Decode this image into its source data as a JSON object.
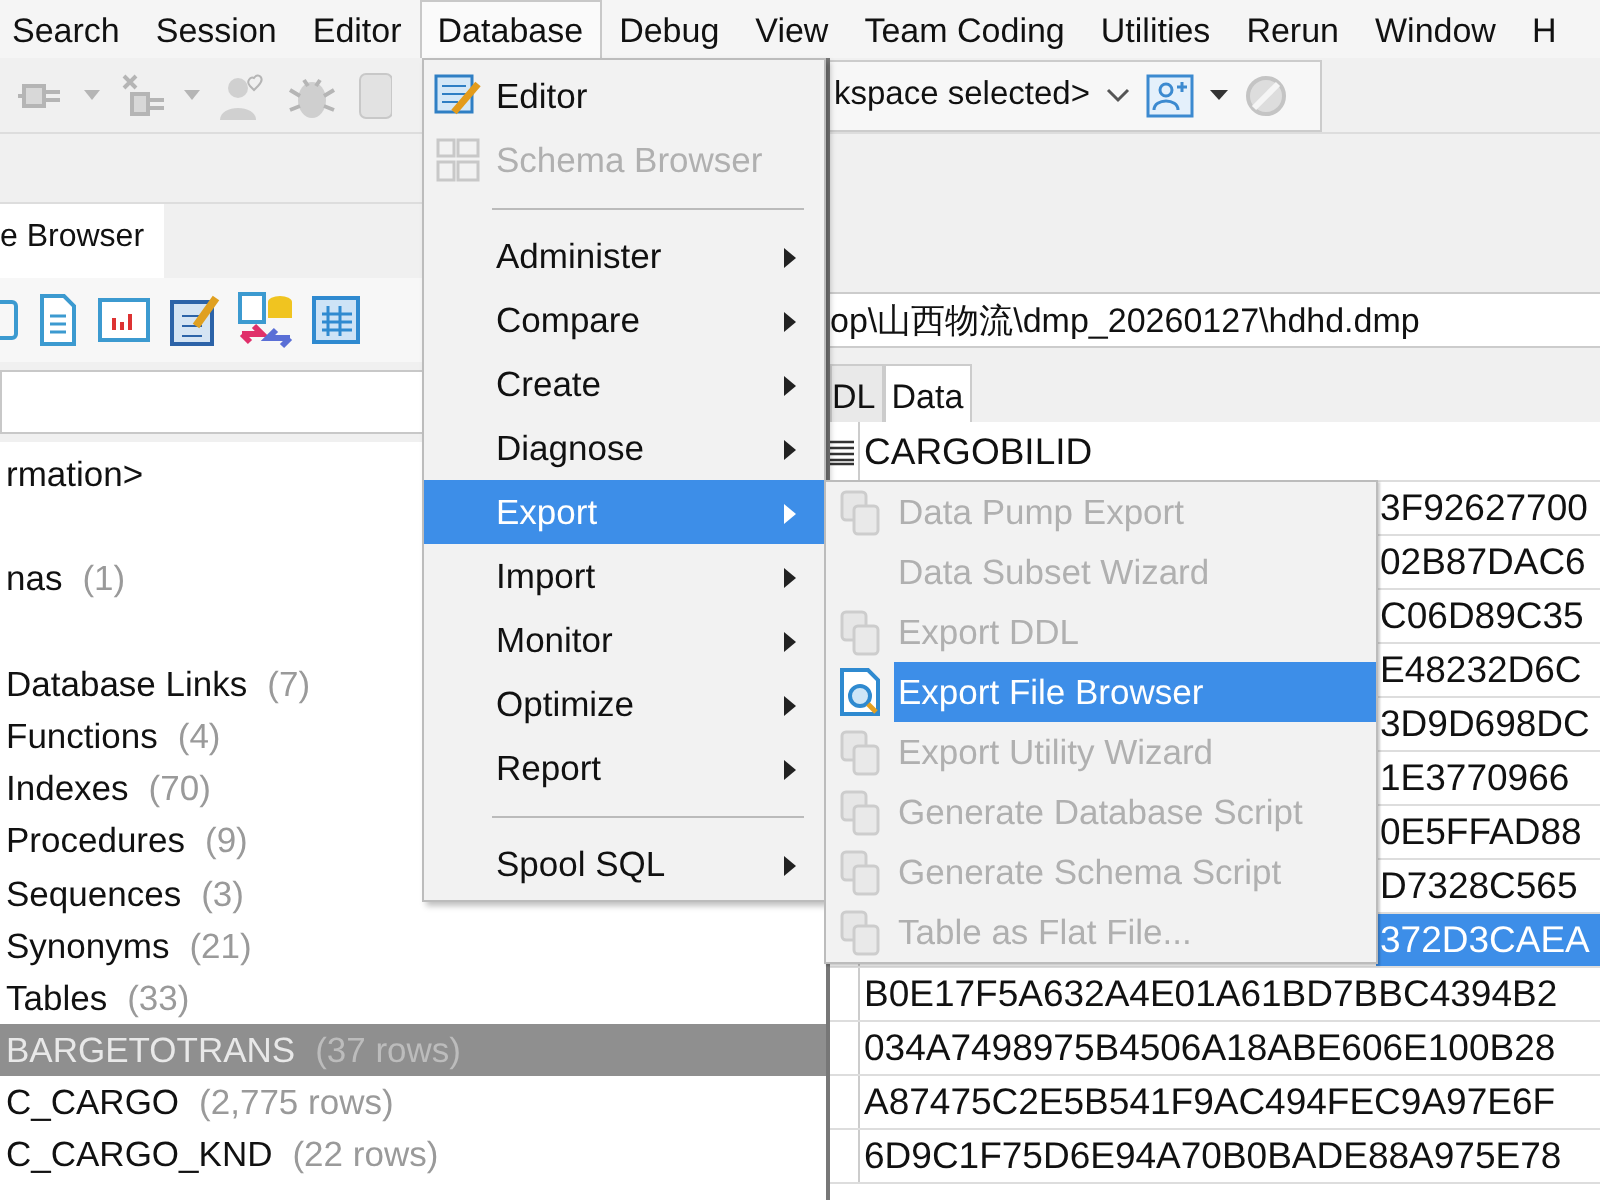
{
  "menubar": [
    {
      "label": "Search",
      "selected": false
    },
    {
      "label": "Session",
      "selected": false
    },
    {
      "label": "Editor",
      "selected": false
    },
    {
      "label": "Database",
      "selected": true
    },
    {
      "label": "Debug",
      "selected": false
    },
    {
      "label": "View",
      "selected": false
    },
    {
      "label": "Team Coding",
      "selected": false
    },
    {
      "label": "Utilities",
      "selected": false
    },
    {
      "label": "Rerun",
      "selected": false
    },
    {
      "label": "Window",
      "selected": false
    },
    {
      "label": "H",
      "selected": false
    }
  ],
  "workspace": {
    "value": "kspace selected>"
  },
  "browser_tab": {
    "label": "e Browser",
    "selected": true
  },
  "tree": [
    {
      "label": "rmation>"
    },
    {
      "label": "nas",
      "count": "(1)",
      "children": [
        {
          "label": "Database Links",
          "count": "(7)"
        },
        {
          "label": "Functions",
          "count": "(4)"
        },
        {
          "label": "Indexes",
          "count": "(70)"
        },
        {
          "label": "Procedures",
          "count": "(9)"
        },
        {
          "label": "Sequences",
          "count": "(3)"
        },
        {
          "label": "Synonyms",
          "count": "(21)"
        },
        {
          "label": "Tables",
          "count": "(33)",
          "children": [
            {
              "label": "BARGETOTRANS",
              "count": "(37 rows)",
              "selected": true
            },
            {
              "label": "C_CARGO",
              "count": "(2,775 rows)",
              "selected": false
            },
            {
              "label": "C_CARGO_KND",
              "count": "(22 rows)",
              "selected": false
            }
          ]
        }
      ]
    }
  ],
  "file_path": "op\\山西物流\\dmp_20260127\\hdhd.dmp",
  "detail_tabs": [
    {
      "label": "DL",
      "selected": false
    },
    {
      "label": "Data",
      "selected": true
    }
  ],
  "grid": {
    "column": "CARGOBILID",
    "rows": [
      {
        "value": "3F92627700",
        "covered": true,
        "selected": false
      },
      {
        "value": "02B87DAC6",
        "covered": true,
        "selected": false
      },
      {
        "value": "C06D89C35",
        "covered": true,
        "selected": false
      },
      {
        "value": "E48232D6C",
        "covered": true,
        "selected": false
      },
      {
        "value": "3D9D698DC",
        "covered": true,
        "selected": false
      },
      {
        "value": "1E3770966",
        "covered": true,
        "selected": false
      },
      {
        "value": "0E5FFAD88",
        "covered": true,
        "selected": false
      },
      {
        "value": "D7328C565",
        "covered": true,
        "selected": false
      },
      {
        "value": "372D3CAEA",
        "covered": true,
        "selected": true
      },
      {
        "value": "B0E17F5A632A4E01A61BD7BBC4394B2",
        "covered": false,
        "selected": false
      },
      {
        "value": "034A7498975B4506A18ABE606E100B28",
        "covered": false,
        "selected": false
      },
      {
        "value": "A87475C2E5B541F9AC494FEC9A97E6F",
        "covered": false,
        "selected": false
      },
      {
        "value": "6D9C1F75D6E94A70B0BADE88A975E78",
        "covered": false,
        "selected": false
      }
    ]
  },
  "database_menu": [
    {
      "label": "Editor",
      "kind": "icon_item",
      "disabled": false,
      "submenu": false,
      "selected": false
    },
    {
      "label": "Schema Browser",
      "kind": "icon_item",
      "disabled": true,
      "submenu": false,
      "selected": false
    },
    {
      "kind": "separator"
    },
    {
      "label": "Administer",
      "kind": "item",
      "disabled": false,
      "submenu": true,
      "selected": false
    },
    {
      "label": "Compare",
      "kind": "item",
      "disabled": false,
      "submenu": true,
      "selected": false
    },
    {
      "label": "Create",
      "kind": "item",
      "disabled": false,
      "submenu": true,
      "selected": false
    },
    {
      "label": "Diagnose",
      "kind": "item",
      "disabled": false,
      "submenu": true,
      "selected": false
    },
    {
      "label": "Export",
      "kind": "item",
      "disabled": false,
      "submenu": true,
      "selected": true
    },
    {
      "label": "Import",
      "kind": "item",
      "disabled": false,
      "submenu": true,
      "selected": false
    },
    {
      "label": "Monitor",
      "kind": "item",
      "disabled": false,
      "submenu": true,
      "selected": false
    },
    {
      "label": "Optimize",
      "kind": "item",
      "disabled": false,
      "submenu": true,
      "selected": false
    },
    {
      "label": "Report",
      "kind": "item",
      "disabled": false,
      "submenu": true,
      "selected": false
    },
    {
      "kind": "separator"
    },
    {
      "label": "Spool SQL",
      "kind": "item",
      "disabled": false,
      "submenu": true,
      "selected": false
    }
  ],
  "export_menu": [
    {
      "label": "Data Pump Export",
      "kind": "icon_item",
      "disabled": true,
      "selected": false
    },
    {
      "label": "Data Subset Wizard",
      "kind": "item",
      "disabled": true,
      "selected": false
    },
    {
      "label": "Export DDL",
      "kind": "icon_item",
      "disabled": true,
      "selected": false
    },
    {
      "label": "Export File Browser",
      "kind": "icon_item",
      "disabled": false,
      "selected": true
    },
    {
      "label": "Export Utility Wizard",
      "kind": "icon_item",
      "disabled": true,
      "selected": false
    },
    {
      "label": "Generate Database Script",
      "kind": "icon_item",
      "disabled": true,
      "selected": false
    },
    {
      "label": "Generate Schema Script",
      "kind": "icon_item",
      "disabled": true,
      "selected": false
    },
    {
      "label": "Table as Flat File...",
      "kind": "icon_item",
      "disabled": true,
      "selected": false
    }
  ]
}
